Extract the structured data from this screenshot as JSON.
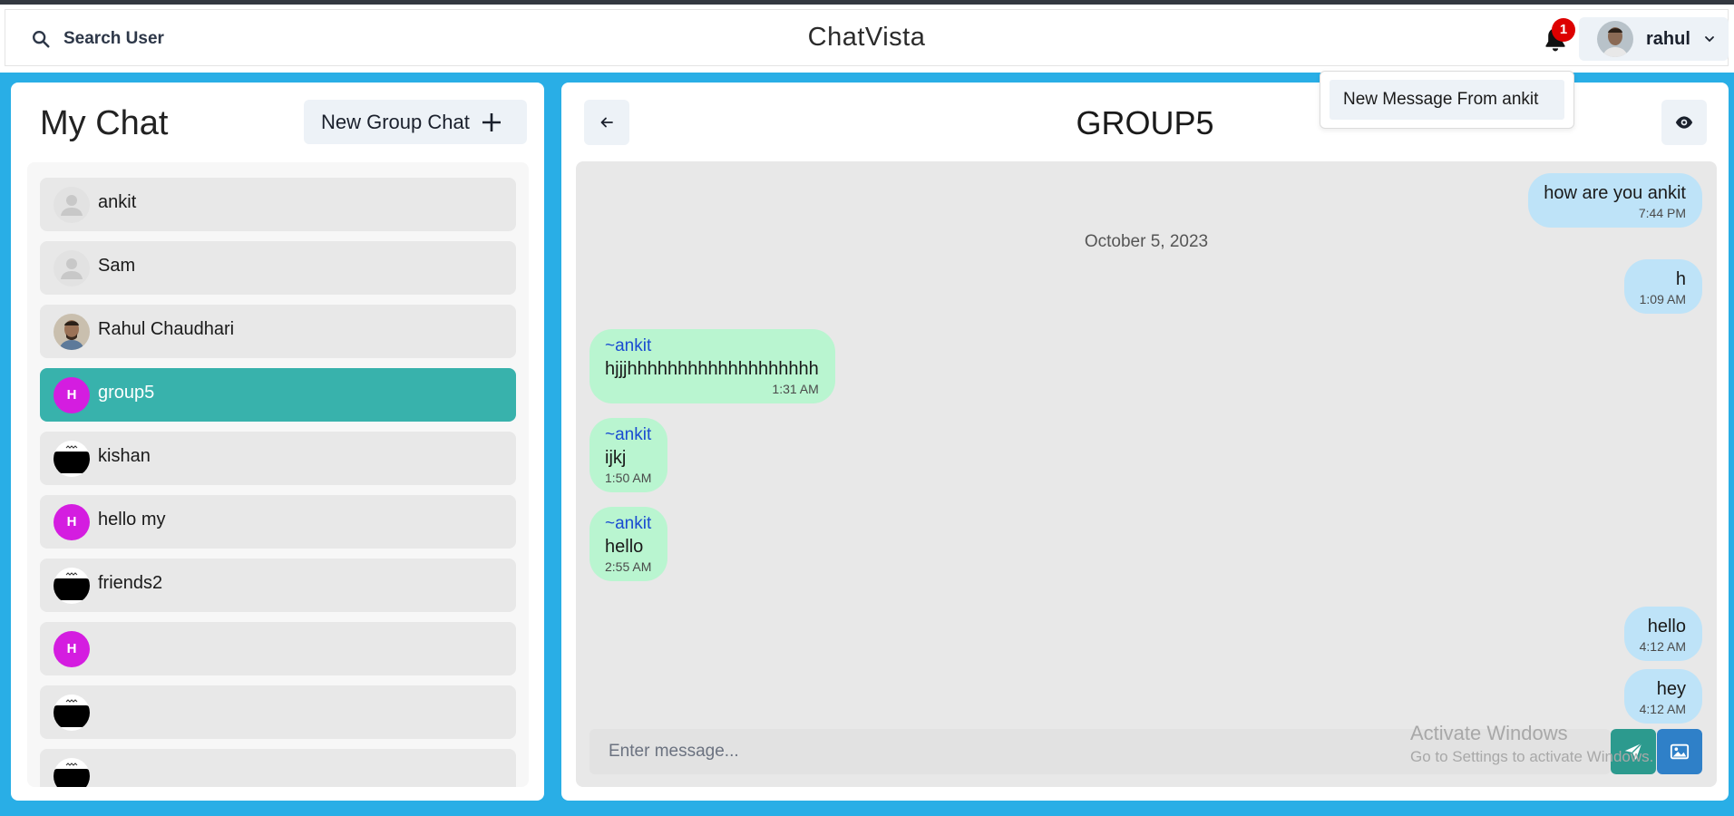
{
  "header": {
    "search_label": "Search User",
    "app_title": "ChatVista",
    "notification_count": "1",
    "username": "rahul"
  },
  "notifications": {
    "items": [
      "New Message From ankit"
    ]
  },
  "sidebar": {
    "title": "My Chat",
    "new_group_label": "New Group Chat",
    "chats": [
      {
        "name": "ankit",
        "avatar": "default-user"
      },
      {
        "name": "Sam",
        "avatar": "default-user"
      },
      {
        "name": "Rahul Chaudhari",
        "avatar": "photo"
      },
      {
        "name": "group5",
        "avatar": "H",
        "active": true
      },
      {
        "name": "kishan",
        "avatar": "black-image"
      },
      {
        "name": "hello my",
        "avatar": "H"
      },
      {
        "name": "friends2",
        "avatar": "black-image"
      },
      {
        "name": "",
        "avatar": "H"
      },
      {
        "name": "",
        "avatar": "black-image"
      },
      {
        "name": "",
        "avatar": "black-image"
      }
    ]
  },
  "chat": {
    "title": "GROUP5",
    "date_separator": "October 5, 2023",
    "messages": [
      {
        "from": "me",
        "text": "how are you ankit",
        "time": "7:44 PM"
      },
      {
        "from": "me",
        "text": "h",
        "time": "1:09 AM"
      },
      {
        "from": "them",
        "sender": "~ankit",
        "text": "hjjjhhhhhhhhhhhhhhhhhhh",
        "time": "1:31 AM"
      },
      {
        "from": "them",
        "sender": "~ankit",
        "text": "ijkj",
        "time": "1:50 AM"
      },
      {
        "from": "them",
        "sender": "~ankit",
        "text": "hello",
        "time": "2:55 AM"
      },
      {
        "from": "me",
        "text": "hello",
        "time": "4:12 AM"
      },
      {
        "from": "me",
        "text": "hey",
        "time": "4:12 AM"
      }
    ],
    "input_placeholder": "Enter message..."
  },
  "watermark": {
    "line1": "Activate Windows",
    "line2": "Go to Settings to activate Windows."
  },
  "colors": {
    "frame": "#29aee6",
    "active_chat": "#38b2ac",
    "group_avatar": "#d41de0",
    "my_bubble": "#bee3f8",
    "their_bubble": "#b9f5d0",
    "send_button": "#2c9a8e",
    "image_button": "#2f80c8",
    "badge": "#dd0000"
  },
  "icons": {
    "search": "search-icon",
    "bell": "bell-icon",
    "chevron": "chevron-down-icon",
    "plus": "plus-icon",
    "back": "arrow-left-icon",
    "eye": "eye-icon",
    "send": "send-icon",
    "image": "image-icon"
  }
}
